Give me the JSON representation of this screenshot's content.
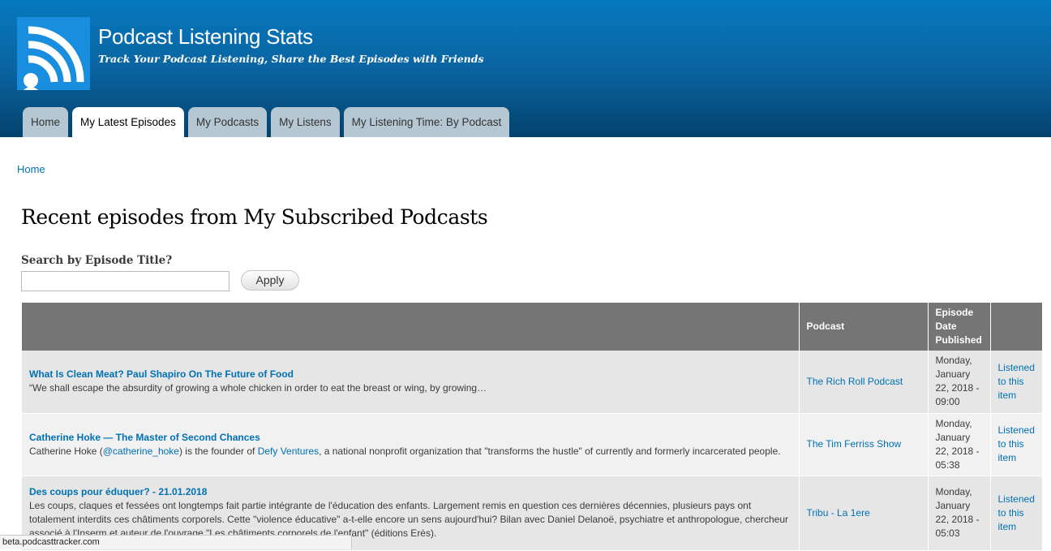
{
  "site": {
    "name": "Podcast Listening Stats",
    "slogan": "Track Your Podcast Listening, Share the Best Episodes with Friends"
  },
  "tabs": [
    {
      "label": "Home",
      "active": false
    },
    {
      "label": "My Latest Episodes",
      "active": true
    },
    {
      "label": "My Podcasts",
      "active": false
    },
    {
      "label": "My Listens",
      "active": false
    },
    {
      "label": "My Listening Time: By Podcast",
      "active": false
    }
  ],
  "breadcrumb": "Home",
  "page_title": "Recent episodes from My Subscribed Podcasts",
  "search": {
    "label": "Search by Episode Title?",
    "value": "",
    "apply_label": "Apply"
  },
  "table": {
    "headers": {
      "episode": "",
      "podcast": "Podcast",
      "date": "Episode Date Published",
      "action": ""
    },
    "rows": [
      {
        "title": "What Is Clean Meat? Paul Shapiro On The Future of Food",
        "description": "“We shall escape the absurdity of growing a whole chicken in order to eat the breast or wing, by growing…",
        "podcast": "The Rich Roll Podcast",
        "date": "Monday, January 22, 2018 - 09:00",
        "action": "Listened to this item"
      },
      {
        "title": "Catherine Hoke — The Master of Second Chances",
        "desc_before": "Catherine Hoke (",
        "desc_link1": "@catherine_hoke",
        "desc_middle": ") is the founder of ",
        "desc_link2": "Defy Ventures",
        "desc_after": ", a national nonprofit organization that \"transforms the hustle\" of currently and formerly incarcerated people.",
        "podcast": "The Tim Ferriss Show",
        "date": "Monday, January 22, 2018 - 05:38",
        "action": "Listened to this item"
      },
      {
        "title": "Des coups pour éduquer? - 21.01.2018",
        "description": "Les coups, claques et fessées ont longtemps fait partie intégrante de l'éducation des enfants. Largement remis en question ces dernières décennies, plusieurs pays ont totalement interdits ces châtiments corporels. Cette \"violence éducative\" a-t-elle encore un sens aujourd'hui? Bilan avec Daniel Delanoë, psychiatre et anthropologue, chercheur associé à l'Inserm et auteur de l'ouvrage \"Les châtiments corporels de l'enfant\" (éditions Erès).",
        "podcast": "Tribu - La 1ere",
        "date": "Monday, January 22, 2018 - 05:03",
        "action": "Listened to this item"
      }
    ]
  },
  "status_bar": "beta.podcasttracker.com",
  "icons": {
    "logo": "podcast-broadcast-icon"
  },
  "colors": {
    "header_top": "#0779bf",
    "header_bottom": "#04426e",
    "link": "#0071b3",
    "table_header": "#757575"
  }
}
